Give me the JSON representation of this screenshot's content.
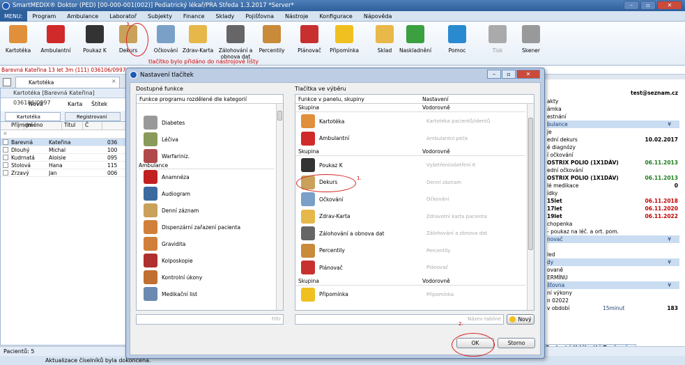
{
  "app": {
    "title": "SmartMEDIX® Doktor (PED) [00-000-001(002)] Pediatrický lékař/PRA Středa 1.3.2017 *Server*"
  },
  "menu": [
    "MENU:",
    "Program",
    "Ambulance",
    "Laboratoř",
    "Subjekty",
    "Finance",
    "Sklady",
    "Pojišťovna",
    "Nástroje",
    "Konfigurace",
    "Nápověda"
  ],
  "toolbar": [
    {
      "label": "Kartotéka",
      "icon": "people-icon"
    },
    {
      "label": "Ambulantní",
      "icon": "ambulance-a-icon"
    },
    {
      "label": "Poukaz K",
      "icon": "k-letter-icon"
    },
    {
      "label": "Dekurs",
      "icon": "dekurs-icon"
    },
    {
      "label": "Očkování",
      "icon": "syringe-icon"
    },
    {
      "label": "Zdrav-Karta",
      "icon": "health-card-icon"
    },
    {
      "label": "Zálohování a obnova dat",
      "icon": "backup-icon"
    },
    {
      "label": "Percentily",
      "icon": "percentile-icon"
    },
    {
      "label": "Plánovač",
      "icon": "calendar-icon"
    },
    {
      "label": "Připomínka",
      "icon": "bulb-icon"
    },
    {
      "label": "Sklad",
      "icon": "folder-icon"
    },
    {
      "label": "Naskladnění",
      "icon": "folder-add-icon"
    },
    {
      "label": "Pomoc",
      "icon": "help-icon"
    },
    {
      "label": "Tisk",
      "icon": "printer-icon"
    },
    {
      "label": "Skener",
      "icon": "scanner-icon"
    }
  ],
  "annotation": {
    "hint": "tlačítko bylo přidáno do nástrojové lišty",
    "step1": "1.",
    "step2": "2.",
    "step3": "3."
  },
  "patient_bar": "Barevná Kateřina 13 let 3m (111) 036106/0997",
  "left": {
    "tab": "Kartotéka",
    "header": "Kartotéka [Barevná Kateřina] 036106/0997",
    "actions": [
      "Nová",
      "Karta",
      "Štítek"
    ],
    "subtabs": [
      "Kartotéka",
      "Registrovaní"
    ],
    "columns": [
      "Příjmení",
      "Jméno",
      "Titul",
      "Č"
    ],
    "rows": [
      {
        "last": "Barevná",
        "first": "Kateřina",
        "num": "036"
      },
      {
        "last": "Dlouhý",
        "first": "Michal",
        "num": "100"
      },
      {
        "last": "Kudrnatá",
        "first": "Aloisie",
        "num": "095"
      },
      {
        "last": "Stolová",
        "first": "Hana",
        "num": "115"
      },
      {
        "last": "Zrzavý",
        "first": "Jan",
        "num": "006"
      }
    ]
  },
  "status": {
    "count": "Pacientů: 5",
    "message": "Aktualizace číselníků byla dokončena."
  },
  "right": {
    "email": "test@seznam.cz",
    "rows": [
      {
        "text": "akty",
        "value": ""
      },
      {
        "text": "ámka",
        "value": ""
      },
      {
        "text": "estnání",
        "value": ""
      },
      {
        "text": "bulance",
        "value": "",
        "section": true
      },
      {
        "text": "je",
        "value": ""
      },
      {
        "text": "ední dekurs",
        "value": "10.02.2017",
        "color": "#000"
      },
      {
        "text": "é diagnózy",
        "value": ""
      },
      {
        "text": "í očkování",
        "value": ""
      },
      {
        "text": "OSTRIX POLIO (1X1DÁV)",
        "value": "06.11.2013",
        "color": "#1b7a1b"
      },
      {
        "text": "ední očkování",
        "value": ""
      },
      {
        "text": "OSTRIX POLIO (1X1DÁV)",
        "value": "06.11.2013",
        "color": "#1b7a1b"
      },
      {
        "text": "lé medikace",
        "value": "0",
        "color": "#000"
      },
      {
        "text": "ídky",
        "value": ""
      },
      {
        "text": "15let",
        "value": "06.11.2018",
        "color": "#c00000"
      },
      {
        "text": "17let",
        "value": "06.11.2020",
        "color": "#c00000"
      },
      {
        "text": "19let",
        "value": "06.11.2022",
        "color": "#c00000"
      },
      {
        "text": "chopenka",
        "value": ""
      },
      {
        "text": "- poukaz na léč. a ort. pom.",
        "value": ""
      },
      {
        "text": "novač",
        "value": "",
        "section": true
      },
      {
        "text": "",
        "value": ""
      },
      {
        "text": "led",
        "value": ""
      },
      {
        "text": "dy",
        "value": "",
        "section": true
      },
      {
        "text": "ovaně",
        "value": ""
      },
      {
        "text": "ERMÍNU",
        "value": ""
      },
      {
        "text": "šťovna",
        "value": "",
        "section": true
      },
      {
        "text": "ní výkony",
        "value": ""
      },
      {
        "text": "n 02022",
        "value": ""
      },
      {
        "text": "v období",
        "value": "183",
        "extra": "15minut"
      }
    ],
    "tabs": [
      "Pacient",
      "Události",
      "Zprávy",
      ">"
    ]
  },
  "dialog": {
    "title": "Nastavení tlačítek",
    "left_label": "Dostupné funkce",
    "left_header": "Funkce programu rozdělené dle kategorií",
    "left_items": [
      {
        "label": "Diabetes",
        "icon": "diabetes-icon"
      },
      {
        "label": "Léčiva",
        "icon": "medicine-icon"
      },
      {
        "label": "Warfariniz.",
        "icon": "warfarin-icon"
      }
    ],
    "left_section": "Ambulance",
    "left_items2": [
      {
        "label": "Anamnéza",
        "icon": "anamnesis-icon"
      },
      {
        "label": "Audiogram",
        "icon": "audiogram-icon"
      },
      {
        "label": "Denní záznam",
        "icon": "daily-record-icon"
      },
      {
        "label": "Dispenzární zařazení pacienta",
        "icon": "dispensary-icon"
      },
      {
        "label": "Gravidita",
        "icon": "pregnancy-icon"
      },
      {
        "label": "Kolposkopie",
        "icon": "colposcopy-icon"
      },
      {
        "label": "Kontrolní úkony",
        "icon": "control-icon"
      },
      {
        "label": "Medikační list",
        "icon": "medication-icon"
      }
    ],
    "filter_btn": "Filtr",
    "right_label": "Tlačítka ve výběru",
    "right_col1": "Funkce v panelu, skupiny",
    "right_col2": "Nastavení",
    "groups": [
      {
        "name": "Skupina",
        "setting": "Vodorovně",
        "items": [
          {
            "label": "Kartotéka",
            "setting": "Kartotéka pacientů/identů",
            "icon": "people-icon"
          },
          {
            "label": "Ambulantní",
            "setting": "Ambulantní péče",
            "icon": "ambulance-a-icon"
          }
        ]
      },
      {
        "name": "Skupina",
        "setting": "Vodorovně",
        "items": [
          {
            "label": "Poukaz K",
            "setting": "Vyšetření/ošetření K",
            "icon": "k-letter-icon"
          },
          {
            "label": "Dekurs",
            "setting": "Denní záznam",
            "icon": "dekurs-icon"
          },
          {
            "label": "Očkování",
            "setting": "Očkování",
            "icon": "syringe-icon"
          },
          {
            "label": "Zdrav-Karta",
            "setting": "Zdravotní karta pacienta",
            "icon": "health-card-icon"
          },
          {
            "label": "Zálohování a obnova dat",
            "setting": "Zálohování a obnova dat",
            "icon": "backup-icon"
          },
          {
            "label": "Percentily",
            "setting": "Percentily",
            "icon": "percentile-icon"
          },
          {
            "label": "Plánovač",
            "setting": "Plánovač",
            "icon": "calendar-icon"
          }
        ]
      },
      {
        "name": "Skupina",
        "setting": "Vodorovně",
        "items": [
          {
            "label": "Připomínka",
            "setting": "Připomínka",
            "icon": "bulb-icon"
          }
        ]
      }
    ],
    "new_name_placeholder": "Název tabline",
    "new_btn": "Nový",
    "ok": "OK",
    "cancel": "Storno"
  }
}
